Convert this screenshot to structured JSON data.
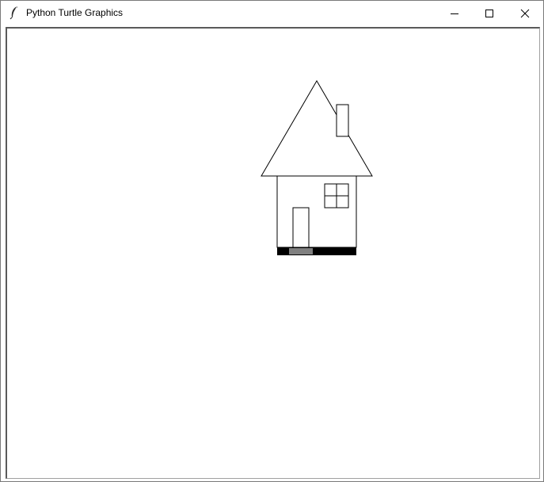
{
  "window": {
    "title": "Python Turtle Graphics",
    "icon": "feather-icon",
    "controls": {
      "minimize_icon": "minimize-icon",
      "maximize_icon": "maximize-icon",
      "close_icon": "close-icon"
    }
  },
  "canvas": {
    "background": "#ffffff",
    "drawing": {
      "subject": "house",
      "stroke_color": "#000000",
      "fill_colors": {
        "foundation": "#000000",
        "step": "#808080"
      }
    }
  },
  "colors": {
    "window_border": "#7a7a7a",
    "client_border": "#5a5a5a",
    "desktop_strip_red": "#d9302c",
    "desktop_strip_blue": "#3a6ea5"
  }
}
